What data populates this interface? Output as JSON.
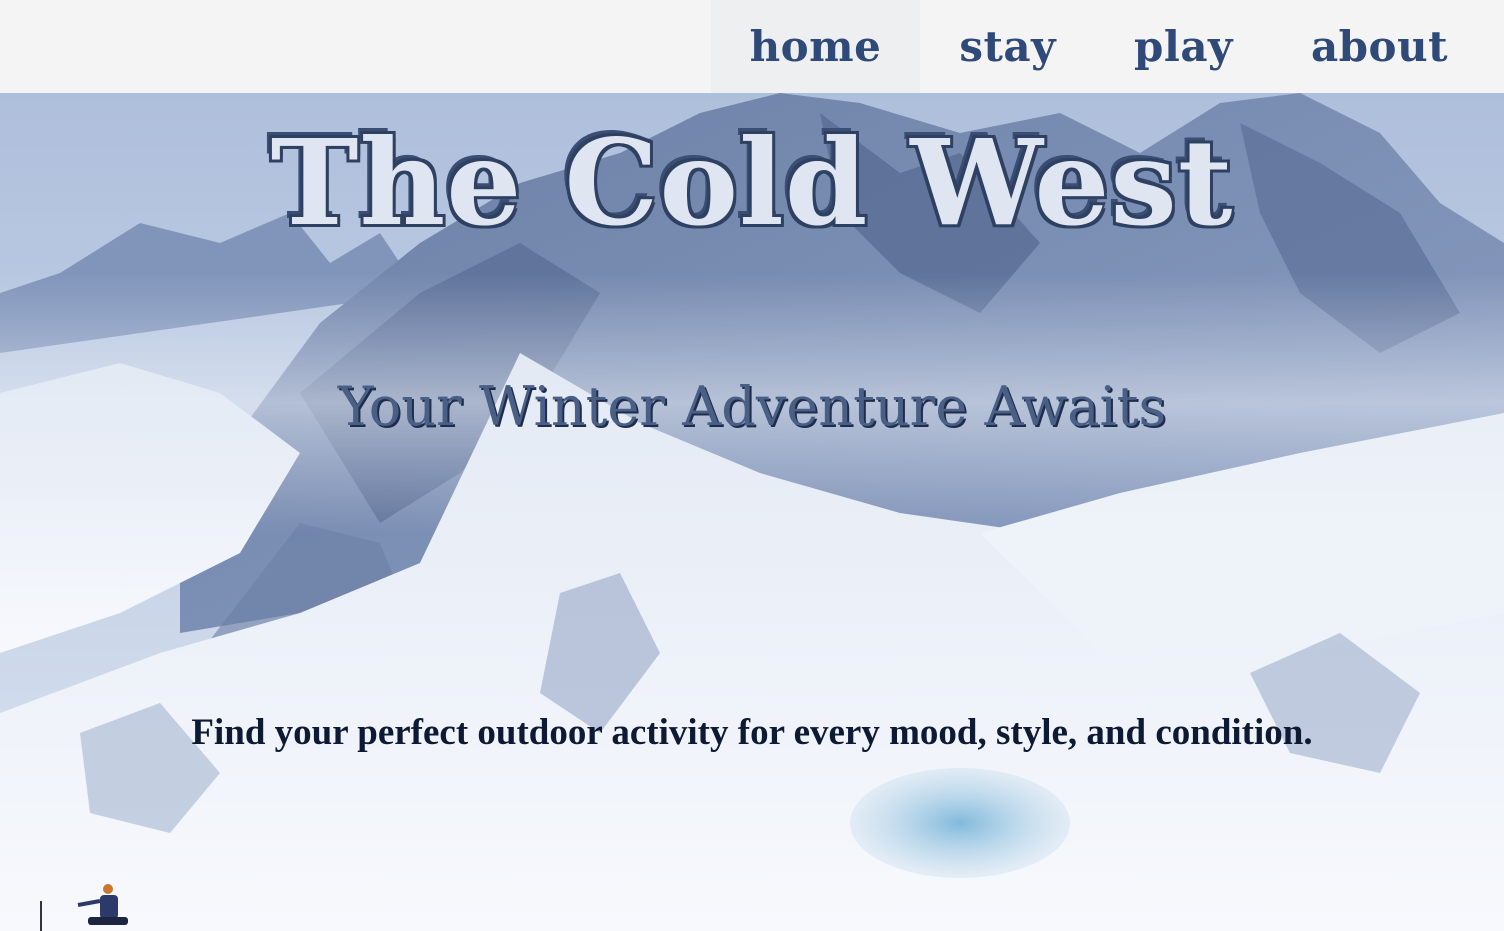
{
  "nav": {
    "items": [
      {
        "label": "home",
        "active": true
      },
      {
        "label": "stay",
        "active": false
      },
      {
        "label": "play",
        "active": false
      },
      {
        "label": "about",
        "active": false
      }
    ]
  },
  "hero": {
    "title": "The Cold West",
    "subtitle": "Your Winter Adventure Awaits",
    "tagline": "Find your perfect outdoor activity for every mood, style, and condition.",
    "background": "snowy-mountain-photo"
  },
  "colors": {
    "nav_background": "#f4f4f5",
    "nav_text": "#2f4a78",
    "title_fill": "#dfe6f2",
    "title_outline": "#2f4163",
    "tagline": "#0d1a33"
  }
}
